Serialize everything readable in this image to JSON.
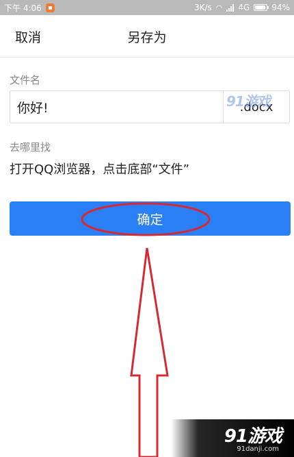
{
  "status_bar": {
    "time": "下午 4:06",
    "net_speed": "3K/s",
    "network": "4G",
    "battery": "94%",
    "icons": [
      "notification-icon",
      "wifi-icon",
      "signal-icon",
      "battery-icon"
    ]
  },
  "header": {
    "cancel_label": "取消",
    "title": "另存为"
  },
  "form": {
    "filename_label": "文件名",
    "filename_value": "你好!",
    "extension": ".docx",
    "location_label": "去哪里找",
    "location_text": "打开QQ浏览器，点击底部“文件”"
  },
  "confirm_label": "确定",
  "annotation_color": "#d42a34",
  "accent_color": "#2a7ff5",
  "watermark": {
    "small_logo": "91游戏",
    "logo": "91游戏",
    "url": "91danji.com"
  }
}
